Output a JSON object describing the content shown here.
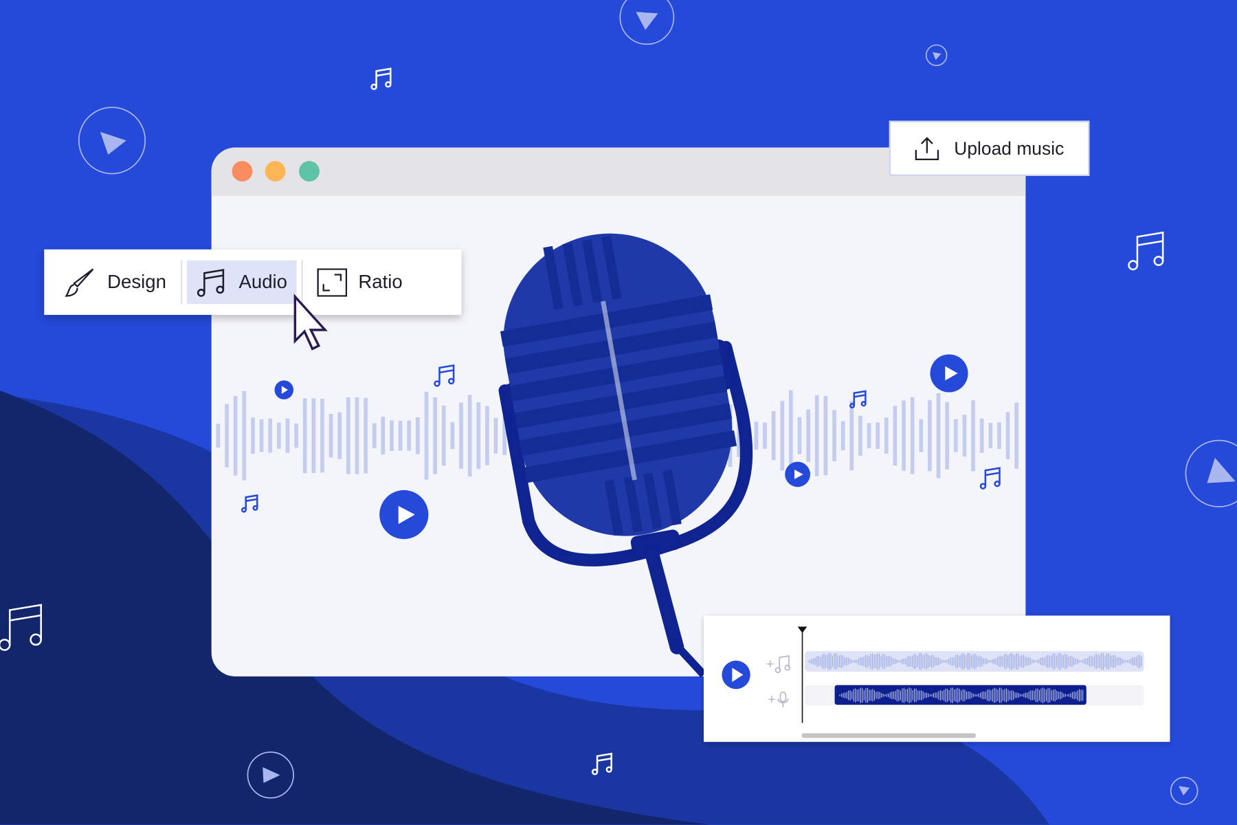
{
  "toolbar": {
    "items": [
      {
        "label": "Design",
        "icon": "paintbrush-icon",
        "active": false
      },
      {
        "label": "Audio",
        "icon": "music-note-icon",
        "active": true
      },
      {
        "label": "Ratio",
        "icon": "aspect-ratio-icon",
        "active": false
      }
    ]
  },
  "upload": {
    "label": "Upload music",
    "icon": "upload-icon"
  },
  "window": {
    "traffic_lights": [
      "#f98d5f",
      "#fcb655",
      "#5fc3a7"
    ]
  },
  "timeline": {
    "tracks": [
      {
        "icon": "add-music-icon",
        "label": "+"
      },
      {
        "icon": "add-voice-icon",
        "label": "+"
      }
    ]
  },
  "colors": {
    "background": "#2549d8",
    "accent": "#2549d8",
    "dark_wave": "#13256b",
    "mic": "#1f3aa8",
    "clip": "#0d1f8f"
  }
}
